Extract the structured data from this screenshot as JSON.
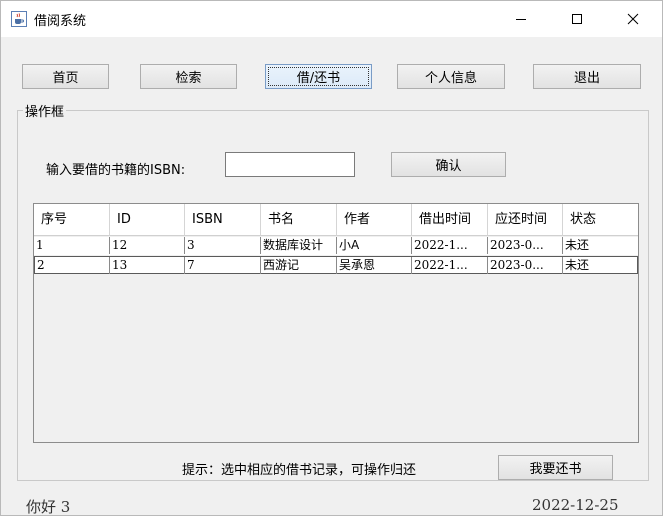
{
  "window": {
    "title": "借阅系统"
  },
  "nav": {
    "home": "首页",
    "search": "检索",
    "borrow_return": "借/还书",
    "profile": "个人信息",
    "logout": "退出"
  },
  "group": {
    "title": "操作框"
  },
  "form": {
    "isbn_label": "输入要借的书籍的ISBN:",
    "isbn_value": "",
    "confirm": "确认"
  },
  "table": {
    "columns": [
      "序号",
      "ID",
      "ISBN",
      "书名",
      "作者",
      "借出时间",
      "应还时间",
      "状态"
    ],
    "rows": [
      [
        "1",
        "12",
        "3",
        "数据库设计",
        "小A",
        "2022-1...",
        "2023-0...",
        "未还"
      ],
      [
        "2",
        "13",
        "7",
        "西游记",
        "吴承恩",
        "2022-1...",
        "2023-0...",
        "未还"
      ]
    ]
  },
  "footer": {
    "hint": "提示：选中相应的借书记录，可操作归还",
    "return_button": "我要还书",
    "greeting": "你好 3",
    "date": "2022-12-25"
  }
}
